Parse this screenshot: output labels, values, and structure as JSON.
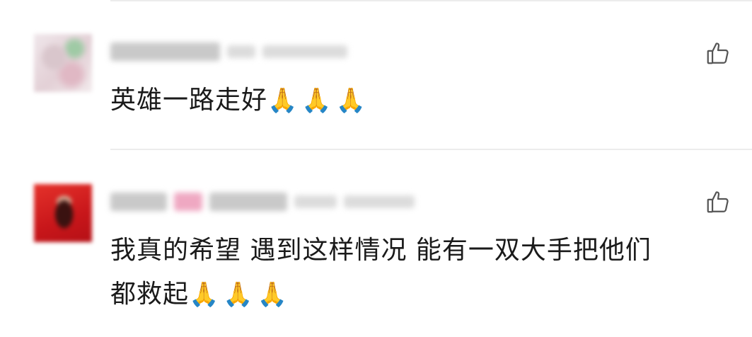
{
  "comments": [
    {
      "text": "英雄一路走好",
      "emoji": "🙏🙏🙏"
    },
    {
      "text_line1": "我真的希望 遇到这样情况 能有一双大手把他们",
      "text_line2": "都救起",
      "emoji": "🙏🙏🙏"
    }
  ],
  "icons": {
    "like": "thumbs-up-outline-icon"
  },
  "colors": {
    "text": "#1a1a1a",
    "icon": "#555555",
    "divider": "#ececec",
    "background": "#ffffff"
  }
}
